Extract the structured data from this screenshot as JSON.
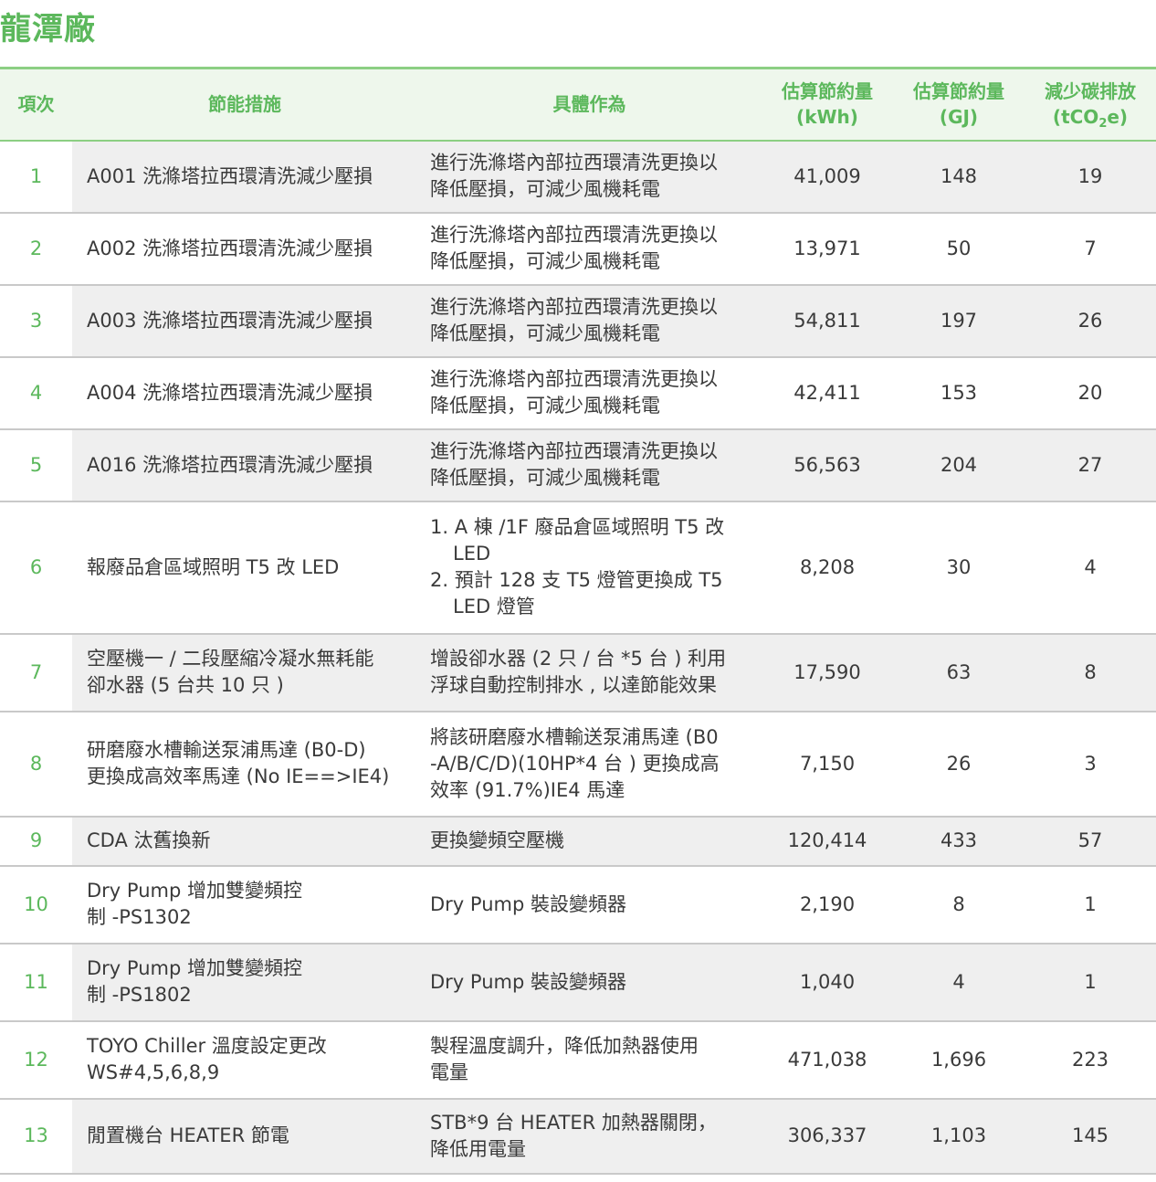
{
  "title": "龍潭廠",
  "headers": {
    "no": "項次",
    "measure": "節能措施",
    "action": "具體作為",
    "kwh_line1": "估算節約量",
    "kwh_line2": "(kWh)",
    "gj_line1": "估算節約量",
    "gj_line2": "(GJ)",
    "co2_line1": "減少碳排放",
    "co2_pre": "(tCO",
    "co2_sub": "2",
    "co2_post": "e)"
  },
  "rows": [
    {
      "no": "1",
      "measure": [
        "A001 洗滌塔拉西環清洗減少壓損"
      ],
      "action": [
        "進行洗滌塔內部拉西環清洗更換以",
        "降低壓損，可減少風機耗電"
      ],
      "kwh": "41,009",
      "gj": "148",
      "co2": "19"
    },
    {
      "no": "2",
      "measure": [
        "A002 洗滌塔拉西環清洗減少壓損"
      ],
      "action": [
        "進行洗滌塔內部拉西環清洗更換以",
        "降低壓損，可減少風機耗電"
      ],
      "kwh": "13,971",
      "gj": "50",
      "co2": "7"
    },
    {
      "no": "3",
      "measure": [
        "A003 洗滌塔拉西環清洗減少壓損"
      ],
      "action": [
        "進行洗滌塔內部拉西環清洗更換以",
        "降低壓損，可減少風機耗電"
      ],
      "kwh": "54,811",
      "gj": "197",
      "co2": "26"
    },
    {
      "no": "4",
      "measure": [
        "A004 洗滌塔拉西環清洗減少壓損"
      ],
      "action": [
        "進行洗滌塔內部拉西環清洗更換以",
        "降低壓損，可減少風機耗電"
      ],
      "kwh": "42,411",
      "gj": "153",
      "co2": "20"
    },
    {
      "no": "5",
      "measure": [
        "A016 洗滌塔拉西環清洗減少壓損"
      ],
      "action": [
        "進行洗滌塔內部拉西環清洗更換以",
        "降低壓損，可減少風機耗電"
      ],
      "kwh": "56,563",
      "gj": "204",
      "co2": "27"
    },
    {
      "no": "6",
      "measure": [
        "報廢品倉區域照明 T5 改 LED"
      ],
      "action": [
        "1. A 棟 /1F 廢品倉區域照明 T5 改",
        "LED",
        "2. 預計 128 支 T5 燈管更換成 T5",
        "LED 燈管"
      ],
      "kwh": "8,208",
      "gj": "30",
      "co2": "4"
    },
    {
      "no": "7",
      "measure": [
        "空壓機一 / 二段壓縮冷凝水無耗能",
        "卻水器 (5 台共 10 只 )"
      ],
      "action": [
        "增設卻水器 (2 只 / 台 *5 台 ) 利用",
        "浮球自動控制排水 , 以達節能效果"
      ],
      "kwh": "17,590",
      "gj": "63",
      "co2": "8"
    },
    {
      "no": "8",
      "measure": [
        "研磨廢水槽輸送泵浦馬達 (B0-D)",
        "更換成高效率馬達 (No IE==>IE4)"
      ],
      "action": [
        "將該研磨廢水槽輸送泵浦馬達 (B0",
        "-A/B/C/D)(10HP*4 台 ) 更換成高",
        "效率 (91.7%)IE4 馬達"
      ],
      "kwh": "7,150",
      "gj": "26",
      "co2": "3"
    },
    {
      "no": "9",
      "measure": [
        "CDA 汰舊換新"
      ],
      "action": [
        "更換變頻空壓機"
      ],
      "kwh": "120,414",
      "gj": "433",
      "co2": "57"
    },
    {
      "no": "10",
      "measure": [
        "Dry Pump 增加雙變頻控",
        "制 -PS1302"
      ],
      "action": [
        "Dry Pump 裝設變頻器"
      ],
      "kwh": "2,190",
      "gj": "8",
      "co2": "1"
    },
    {
      "no": "11",
      "measure": [
        "Dry Pump 增加雙變頻控",
        "制 -PS1802"
      ],
      "action": [
        "Dry Pump 裝設變頻器"
      ],
      "kwh": "1,040",
      "gj": "4",
      "co2": "1"
    },
    {
      "no": "12",
      "measure": [
        "TOYO Chiller 溫度設定更改",
        "WS#4,5,6,8,9"
      ],
      "action": [
        "製程溫度調升，降低加熱器使用",
        "電量"
      ],
      "kwh": "471,038",
      "gj": "1,696",
      "co2": "223"
    },
    {
      "no": "13",
      "measure": [
        "閒置機台 HEATER 節電"
      ],
      "action": [
        "STB*9 台 HEATER 加熱器關閉，",
        "降低用電量"
      ],
      "kwh": "306,337",
      "gj": "1,103",
      "co2": "145"
    }
  ]
}
